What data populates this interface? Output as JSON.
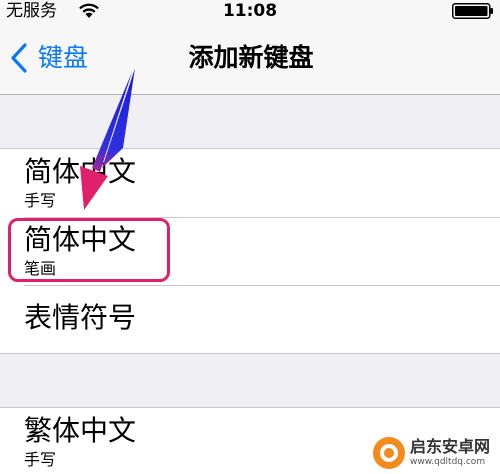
{
  "status_bar": {
    "carrier": "无服务",
    "time": "11:08",
    "wifi_icon": "wifi-icon",
    "battery_icon": "battery-icon"
  },
  "nav": {
    "back_label": "键盘",
    "title": "添加新键盘",
    "accent_color": "#0a78f5"
  },
  "groups": [
    {
      "rows": [
        {
          "title": "简体中文",
          "subtitle": "手写"
        },
        {
          "title": "简体中文",
          "subtitle": "笔画"
        },
        {
          "title": "表情符号",
          "subtitle": ""
        }
      ]
    },
    {
      "rows": [
        {
          "title": "繁体中文",
          "subtitle": "手写"
        }
      ]
    }
  ],
  "annotation": {
    "highlight_color": "#e0206a",
    "arrow_colors": [
      "#1a1adc",
      "#e0206a"
    ]
  },
  "watermark": {
    "name": "启东安卓网",
    "url": "www.qdltdq.com"
  }
}
